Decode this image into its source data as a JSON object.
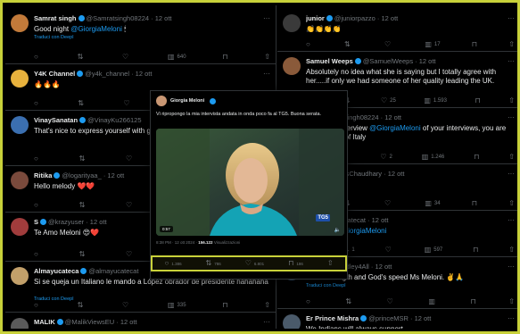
{
  "colors": {
    "accent": "#1d9bf0",
    "frame": "#c8d13a",
    "like_red": "#f91880"
  },
  "translate_label": "Traduci con Deepl",
  "left": [
    {
      "name": "Samrat singh",
      "handle": "@Samratsingh08224 · 12 ott",
      "text": "Good night @GiorgiaMeloni 🕯",
      "translate": true,
      "actions": {
        "reply": "",
        "retweet": "",
        "like": "",
        "views": "640"
      }
    },
    {
      "name": "Y4K Channel",
      "handle": "@y4k_channel · 12 ott",
      "text": "🔥🔥🔥",
      "translate": false,
      "actions": {
        "reply": "",
        "retweet": "",
        "like": "",
        "views": "86"
      }
    },
    {
      "name": "VinaySanatan",
      "handle": "@VinayKu266125",
      "text": "That's nice to express yourself with g",
      "translate": false,
      "actions": {
        "reply": "",
        "retweet": "",
        "like": "",
        "views": ""
      }
    },
    {
      "name": "Ritika",
      "handle": "@logarityaa_ · 12 ott",
      "text": "Hello melody ❤️❤️",
      "translate": false,
      "actions": {
        "reply": "",
        "retweet": "",
        "like": "",
        "views": ""
      }
    },
    {
      "name": "S",
      "handle": "@krazyuser · 12 ott",
      "text": "Te Amo Meloni 😍❤️",
      "translate": false,
      "actions": {
        "reply": "",
        "retweet": "",
        "like": "",
        "views": ""
      }
    },
    {
      "name": "Almayucateca",
      "handle": "@almayucatecat",
      "text": "Si se queja un Italiano le mando a López obrador de presidente hahahaha",
      "translate": true,
      "actions": {
        "reply": "",
        "retweet": "",
        "like": "",
        "views": "335"
      }
    },
    {
      "name": "MALIK",
      "handle": "@MalikViewsEU · 12 ott",
      "text": "Forza meloni",
      "translate": false,
      "actions": {
        "reply": "",
        "retweet": "",
        "like": "",
        "views": ""
      }
    }
  ],
  "right": [
    {
      "name": "junior",
      "handle": "@juniorpazzo · 12 ott",
      "text": "👏👏👏👏",
      "translate": false,
      "actions": {
        "reply": "",
        "retweet": "",
        "like": "",
        "views": "17"
      }
    },
    {
      "name": "Samuel Weeps",
      "handle": "@SamuelWeeps · 12 ott",
      "text": "Absolutely no idea what she is saying but I totally agree with her.....if only we had someone of her quality leading the UK.",
      "translate": true,
      "actions": {
        "reply": "2",
        "retweet": "",
        "like": "25",
        "views": "1.593"
      }
    },
    {
      "name": "",
      "handle": "@Samratsingh08224 · 12 ott",
      "text": "mendable interview @GiorgiaMeloni of your interviews, you are an iron lady of Italy",
      "translate": false,
      "actions": {
        "reply": "",
        "retweet": "",
        "like": "2",
        "views": "1.246"
      }
    },
    {
      "name": "hary",
      "handle": "@TipsChaudhary · 12 ott",
      "text": "",
      "translate": false,
      "actions": {
        "reply": "",
        "retweet": "",
        "like": "",
        "views": "34"
      }
    },
    {
      "name": "",
      "handle": "@almayucatecat · 12 ott",
      "text": "dmirable @GiorgiaMeloni",
      "translate": false,
      "actions": {
        "reply": "",
        "retweet": "1",
        "like": "",
        "views": "597"
      }
    },
    {
      "name": "",
      "handle": "@TimHundley4All · 12 ott",
      "text": "God's strength and God's speed Ms Meloni. ✌️🙏",
      "translate": true,
      "actions": {
        "reply": "",
        "retweet": "",
        "like": "",
        "views": ""
      }
    },
    {
      "name": "Er Prince Mishra",
      "handle": "@princeMSR · 12 ott",
      "text": "We Indians will always support.",
      "translate": false,
      "actions": {
        "reply": "",
        "retweet": "",
        "like": "",
        "views": ""
      }
    }
  ],
  "popup": {
    "author": "Giorgia Meloni",
    "text": "Vi ripropongo la mia intervista andata in onda poco fa al TG5. Buona serata.",
    "video_badge": "0:57",
    "video_logo": "TG5",
    "meta_time": "8:38 PM · 12 ott 2024 · ",
    "meta_views": "156.122",
    "meta_views_label": " Visualizzazioni",
    "actions": [
      "1.386",
      "786",
      "6.801",
      "186",
      ""
    ]
  }
}
